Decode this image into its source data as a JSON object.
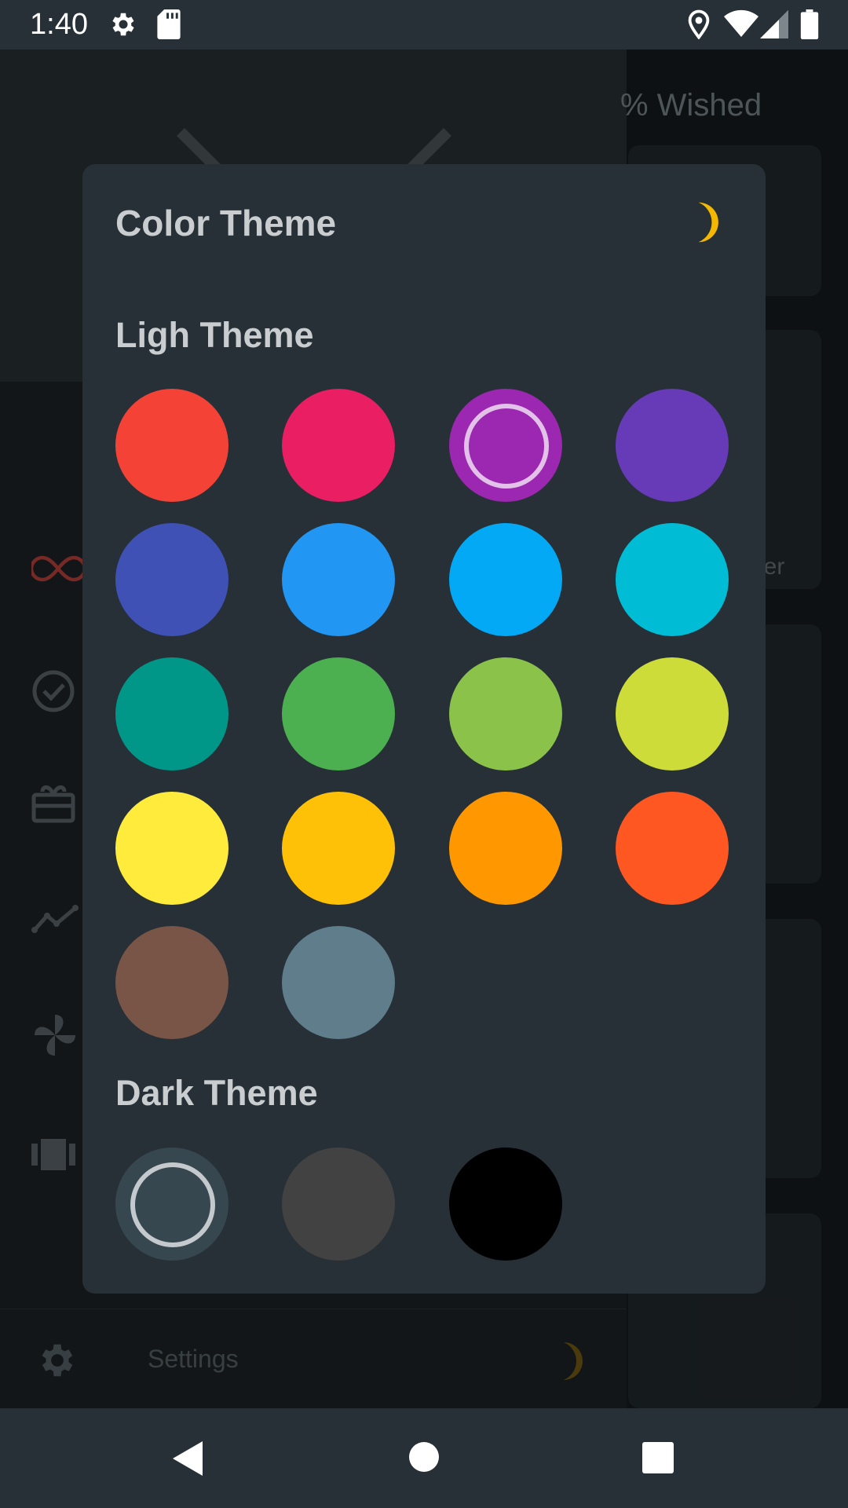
{
  "status_bar": {
    "time": "1:40",
    "icons": [
      "settings-icon",
      "sd-card-icon",
      "location-icon",
      "wifi-icon",
      "signal-icon",
      "battery-icon"
    ]
  },
  "background": {
    "wished_label": "% Wished",
    "cut_label": "ner",
    "drawer_icons": [
      "infinity-icon",
      "check-circle-icon",
      "gift-box-icon",
      "trend-line-icon",
      "pinwheel-icon",
      "film-strip-icon"
    ],
    "settings_label": "Settings",
    "accent": "#c0443d"
  },
  "dialog": {
    "title": "Color Theme",
    "mode_icon": "moon-icon",
    "moon_color": "#f5b800",
    "light_section_title": "Ligh Theme",
    "dark_section_title": "Dark Theme",
    "light_swatches": [
      {
        "name": "red",
        "color": "#f44336",
        "selected": false
      },
      {
        "name": "pink",
        "color": "#e91e63",
        "selected": false
      },
      {
        "name": "purple",
        "color": "#9c27b0",
        "selected": true
      },
      {
        "name": "deep-purple",
        "color": "#673ab7",
        "selected": false
      },
      {
        "name": "indigo",
        "color": "#3f51b5",
        "selected": false
      },
      {
        "name": "blue",
        "color": "#2196f3",
        "selected": false
      },
      {
        "name": "light-blue",
        "color": "#03a9f4",
        "selected": false
      },
      {
        "name": "cyan",
        "color": "#00bcd4",
        "selected": false
      },
      {
        "name": "teal",
        "color": "#009688",
        "selected": false
      },
      {
        "name": "green",
        "color": "#4caf50",
        "selected": false
      },
      {
        "name": "light-green",
        "color": "#8bc34a",
        "selected": false
      },
      {
        "name": "lime",
        "color": "#cddc39",
        "selected": false
      },
      {
        "name": "yellow",
        "color": "#ffeb3b",
        "selected": false
      },
      {
        "name": "amber",
        "color": "#ffc107",
        "selected": false
      },
      {
        "name": "orange",
        "color": "#ff9800",
        "selected": false
      },
      {
        "name": "deep-orange",
        "color": "#ff5722",
        "selected": false
      },
      {
        "name": "brown",
        "color": "#795548",
        "selected": false
      },
      {
        "name": "blue-grey",
        "color": "#607d8b",
        "selected": false
      }
    ],
    "dark_swatches": [
      {
        "name": "dark-slate",
        "color": "#37474f",
        "selected": true
      },
      {
        "name": "dark-grey",
        "color": "#424242",
        "selected": false
      },
      {
        "name": "black",
        "color": "#000000",
        "selected": false
      }
    ]
  },
  "nav_bar": {
    "icons": [
      "back-icon",
      "home-icon",
      "recents-icon"
    ]
  }
}
